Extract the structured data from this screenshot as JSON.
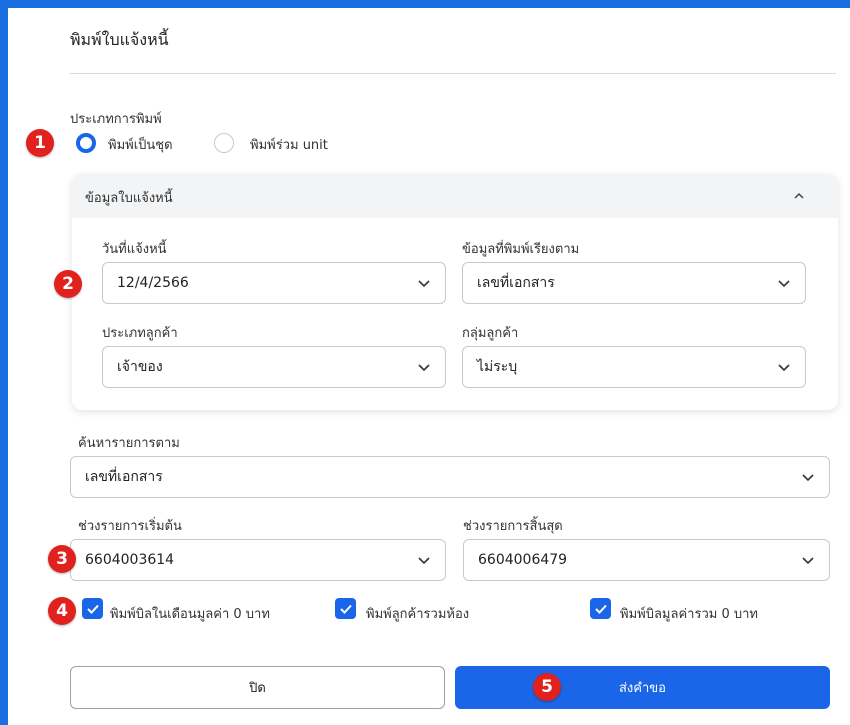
{
  "colors": {
    "accent": "#1b66e8",
    "badge": "#e0211e",
    "frame": "#1a6ee0"
  },
  "dialog": {
    "title": "พิมพ์ใบแจ้งหนี้",
    "print_type": {
      "label": "ประเภทการพิมพ์",
      "options": [
        {
          "label": "พิมพ์เป็นชุด",
          "selected": true
        },
        {
          "label": "พิมพ์ร่วม unit",
          "selected": false
        }
      ]
    },
    "invoice_panel": {
      "title": "ข้อมูลใบแจ้งหนี้",
      "expanded": true,
      "invoice_date": {
        "label": "วันที่แจ้งหนี้",
        "value": "12/4/2566"
      },
      "sort_by": {
        "label": "ข้อมูลที่พิมพ์เรียงตาม",
        "value": "เลขที่เอกสาร"
      },
      "customer_type": {
        "label": "ประเภทลูกค้า",
        "value": "เจ้าของ"
      },
      "customer_group": {
        "label": "กลุ่มลูกค้า",
        "value": "ไม่ระบุ"
      }
    },
    "search_by": {
      "label": "ค้นหารายการตาม",
      "value": "เลขที่เอกสาร"
    },
    "range_start": {
      "label": "ช่วงรายการเริ่มต้น",
      "value": "6604003614"
    },
    "range_end": {
      "label": "ช่วงรายการสิ้นสุด",
      "value": "6604006479"
    },
    "checkboxes": [
      {
        "label": "พิมพ์บิลในเดือนมูลค่า 0 บาท",
        "checked": true
      },
      {
        "label": "พิมพ์ลูกค้ารวมห้อง",
        "checked": true
      },
      {
        "label": "พิมพ์บิลมูลค่ารวม 0 บาท",
        "checked": true
      }
    ],
    "buttons": {
      "close": "ปิด",
      "submit": "ส่งคำขอ"
    }
  },
  "annotations": [
    "1",
    "2",
    "3",
    "4",
    "5"
  ]
}
